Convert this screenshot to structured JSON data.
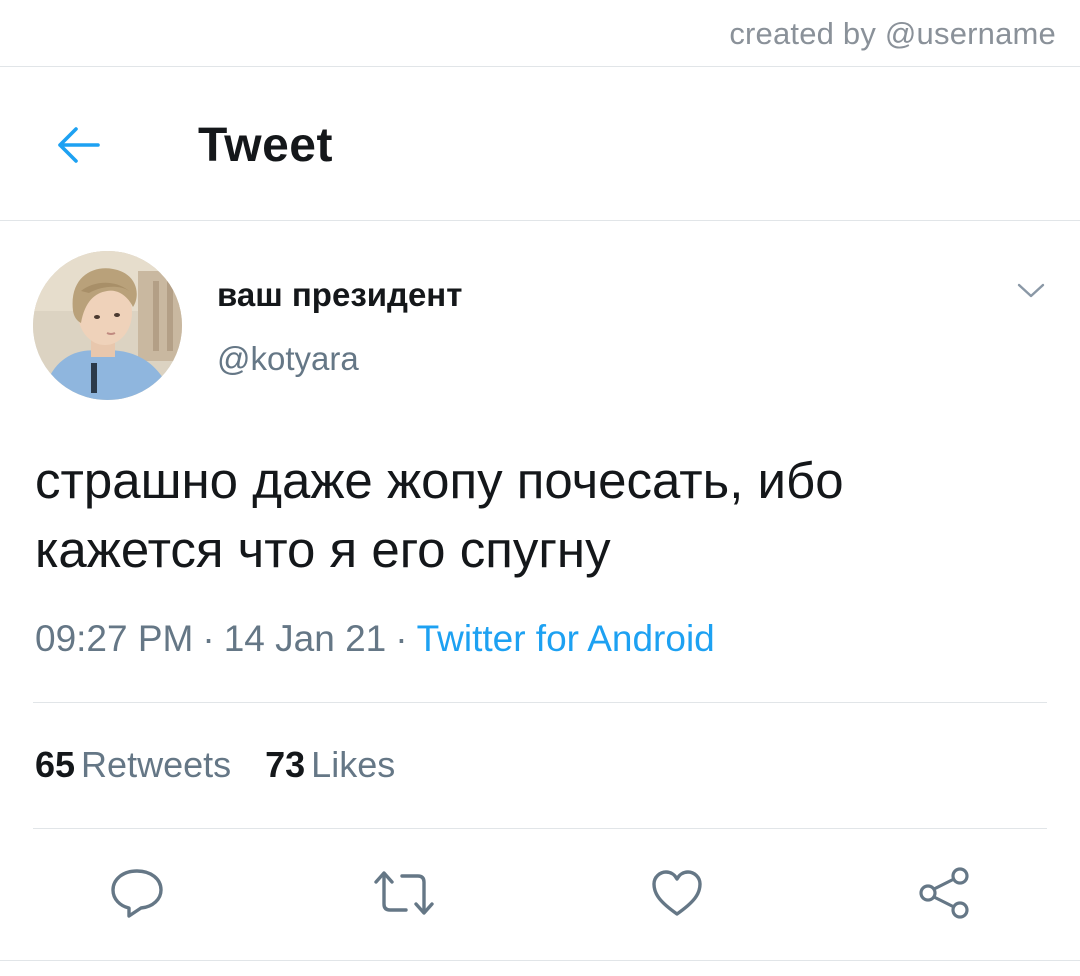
{
  "watermark": "created by @username",
  "header": {
    "back_icon": "arrow-left-icon",
    "title": "Tweet"
  },
  "tweet": {
    "author": {
      "display_name": "ваш президент",
      "handle": "@kotyara"
    },
    "text": "страшно даже жопу почесать, ибо кажется что я его спугну",
    "time": "09:27 PM",
    "separator": "·",
    "date": "14 Jan 21",
    "source": "Twitter for Android",
    "stats": {
      "retweets_count": "65",
      "retweets_label": "Retweets",
      "likes_count": "73",
      "likes_label": "Likes"
    }
  },
  "actions": [
    "reply-icon",
    "retweet-icon",
    "like-icon",
    "share-icon"
  ],
  "colors": {
    "accent": "#1da1f2",
    "text_primary": "#14171a",
    "text_secondary": "#657786",
    "divider": "#e1e5e8",
    "icon": "#657786"
  }
}
